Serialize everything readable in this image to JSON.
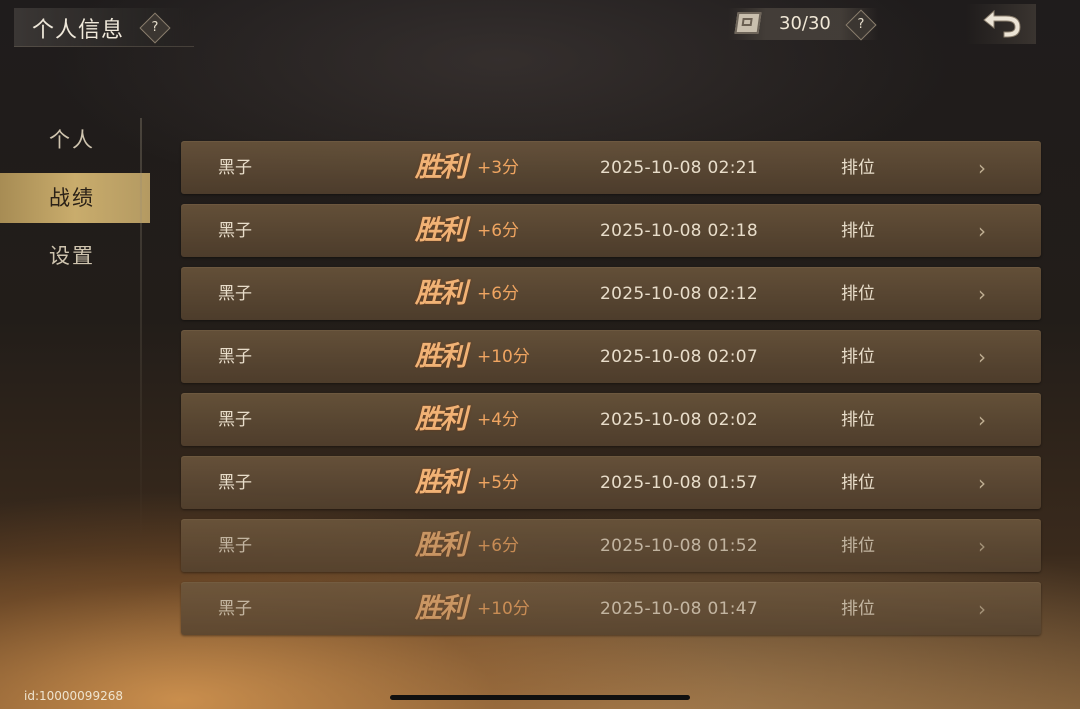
{
  "header": {
    "title": "个人信息",
    "help": "?",
    "counter": "30/30",
    "counter_help": "?"
  },
  "sidebar": {
    "items": [
      {
        "label": "个人",
        "active": false
      },
      {
        "label": "战绩",
        "active": true
      },
      {
        "label": "设置",
        "active": false
      }
    ]
  },
  "records": [
    {
      "piece": "黑子",
      "result": "胜利",
      "score": "+3分",
      "time": "2025-10-08 02:21",
      "mode": "排位",
      "arrow": "›"
    },
    {
      "piece": "黑子",
      "result": "胜利",
      "score": "+6分",
      "time": "2025-10-08 02:18",
      "mode": "排位",
      "arrow": "›"
    },
    {
      "piece": "黑子",
      "result": "胜利",
      "score": "+6分",
      "time": "2025-10-08 02:12",
      "mode": "排位",
      "arrow": "›"
    },
    {
      "piece": "黑子",
      "result": "胜利",
      "score": "+10分",
      "time": "2025-10-08 02:07",
      "mode": "排位",
      "arrow": "›"
    },
    {
      "piece": "黑子",
      "result": "胜利",
      "score": "+4分",
      "time": "2025-10-08 02:02",
      "mode": "排位",
      "arrow": "›"
    },
    {
      "piece": "黑子",
      "result": "胜利",
      "score": "+5分",
      "time": "2025-10-08 01:57",
      "mode": "排位",
      "arrow": "›"
    },
    {
      "piece": "黑子",
      "result": "胜利",
      "score": "+6分",
      "time": "2025-10-08 01:52",
      "mode": "排位",
      "arrow": "›"
    },
    {
      "piece": "黑子",
      "result": "胜利",
      "score": "+10分",
      "time": "2025-10-08 01:47",
      "mode": "排位",
      "arrow": "›"
    }
  ],
  "footer": {
    "user_id": "id:10000099268"
  },
  "icons": {
    "help": "question-mark-icon",
    "book": "book-icon",
    "back": "back-arrow-icon",
    "arrow": "chevron-right-icon"
  },
  "colors": {
    "accent_gold": "#c9ac6c",
    "result_orange": "#f1b275",
    "score_orange": "#f0a561",
    "row_bg": "#6e583e"
  }
}
